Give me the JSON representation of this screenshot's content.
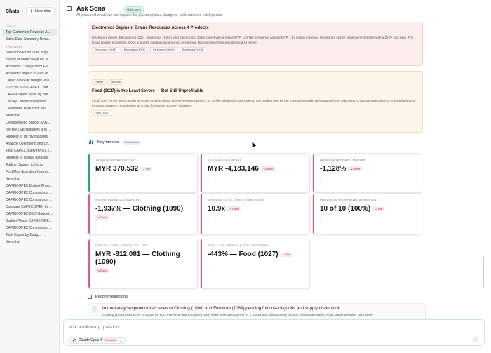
{
  "sidebar": {
    "title": "Chats",
    "new_chat_label": "New chat",
    "sections": {
      "today": "TODAY",
      "this_week": "THIS WEEK"
    },
    "today_items": [
      "Top Customers Revenue A...",
      "Sales Data Summary Requ..."
    ],
    "week_items": [
      "Sleep Impact on Teen Boys",
      "Impact of More Sleep on Te...",
      "Academic Change from FP...",
      "Academic Impact of FPS to...",
      "Capex Opex by Budget Pha...",
      "2025 vs 2026 CAPEX Com...",
      "CAPEX Opex Totals by Buil...",
      "List My Datasets Request",
      "Overspend Reduction and ...",
      "New chat",
      "Overspending Budget Anal...",
      "Identify Overspenders and ...",
      "Request to list my datasets",
      "Analyze Overspend and Un...",
      "Total CAPEX query for Q1 2...",
      "Request to display datasets",
      "Adding Dataset to Sona",
      "Find Max Spending Operat...",
      "New chat",
      "CAPEX OPEX Budget Phas...",
      "CAPEX OPEX Comparison ...",
      "CAPEX OPEX Comparison ...",
      "Compare CAPEX OPEX by ...",
      "CAPEX OPEX 2025 Budget ...",
      "Budget Phase CAPEX OPE...",
      "CAPEX OPEX Comparison ...",
      "Total Capex by Budg...",
      "New chat"
    ]
  },
  "header": {
    "title": "Ask Sona",
    "badge": "Multi-agent",
    "subtitle": "AI-powered analytics workspace for planning data, budgets, and variance intelligence."
  },
  "insights": [
    {
      "title": "Electronics Segment Drains Resources Across 4 Products",
      "description": "Electronics (1048), Electronics (1025), Electronics (1063), and Electronics (1016) collectively produce MYR 140,766 in revenue against MYR 1.34 million in losses. Electronics (1048) is the worst offender with a 13.7× loss ratio. The broad spread across four SKUs suggests category-wide pricing or sourcing failures rather than a single product defect.",
      "tags": [
        "Electronics (1048)",
        "Electronics (1025)",
        "Electronics (1063)",
        "Electronics (1016)"
      ]
    },
    {
      "top_tags": [
        "Pattern",
        "Medium"
      ],
      "title": "Food (1027) is the Least Severe — But Still Unprofitable",
      "description": "Food (1027) is the 'best' margin at -443% and the lowest loss-to-revenue ratio of 4.4×. While still deeply loss-making, this product may be the most salvageable with targeted cost reductions of approximately 80% or a significant price increase strategy. It could serve as a pilot for margin recovery initiatives.",
      "tags": [
        "Food (1027)"
      ]
    }
  ],
  "key_metrics": {
    "title": "Key metrics",
    "count_label": "8 indicators",
    "cards": [
      {
        "label": "TOTAL REVENUE (TOP 10)",
        "value": "MYR 370,532",
        "chip": "Flat",
        "chip_kind": "flat",
        "footer": "-"
      },
      {
        "label": "TOTAL LOSS (TOP 10)",
        "value": "MYR -4,183,146",
        "chip": "Down",
        "chip_kind": "down",
        "footer": "-"
      },
      {
        "label": "AGGREGATE PROFIT MARGIN",
        "value": "-1,128%",
        "chip": "Down",
        "chip_kind": "down",
        "footer": "-"
      },
      {
        "label": "WORST INDIVIDUAL MARGIN",
        "value": "-1,937% — Clothing (1090)",
        "chip": "Down",
        "chip_kind": "down",
        "footer": "-"
      },
      {
        "label": "AVERAGE LOSS-TO-REVENUE RATIO",
        "value": "10.9x",
        "chip": "Down",
        "chip_kind": "down",
        "footer": "-"
      },
      {
        "label": "PRODUCTS WITH NEGATIVE MARGIN",
        "value": "10 of 10 (100%)",
        "chip": "Flat",
        "chip_kind": "flat-pink",
        "footer": "-"
      },
      {
        "label": "LARGEST SINGLE PRODUCT LOSS",
        "value": "MYR -812,081 — Clothing (1090)",
        "chip": "Down",
        "chip_kind": "down",
        "footer": "-"
      },
      {
        "label": "BEST-CASE MARGIN (LEAST NEGATIVE)",
        "value": "-443% — Food (1027)",
        "chip": "Flat",
        "chip_kind": "flat-pink",
        "footer": "-"
      }
    ]
  },
  "recommendations": {
    "title": "Recommendations",
    "items": [
      {
        "number": "1",
        "text": "Immediately suspend or halt sales of Clothing (1090) and Furniture (1089) pending full cost-of-goods and supply-chain audit.",
        "detail": "Clothing (1090) loses MYR 19.40 per MYR 1 of revenue and Furniture (1089) loses MYR 16.00 per MYR 1. Continued sales actively destroy shareholder value. A halt prevents further cash bleed"
      }
    ]
  },
  "composer": {
    "placeholder": "Ask a follow-up question...",
    "model_name": "Claude Opus 4",
    "model_badge": "Powerful",
    "send_icon": "arrow-up-icon"
  },
  "colors": {
    "accent": "#2a7a5a",
    "teal_bar": "#2ea090",
    "pink_bar": "#e05a86",
    "insight_red_bg": "#fdeeee",
    "insight_amber_bg": "#fdf6e9"
  }
}
